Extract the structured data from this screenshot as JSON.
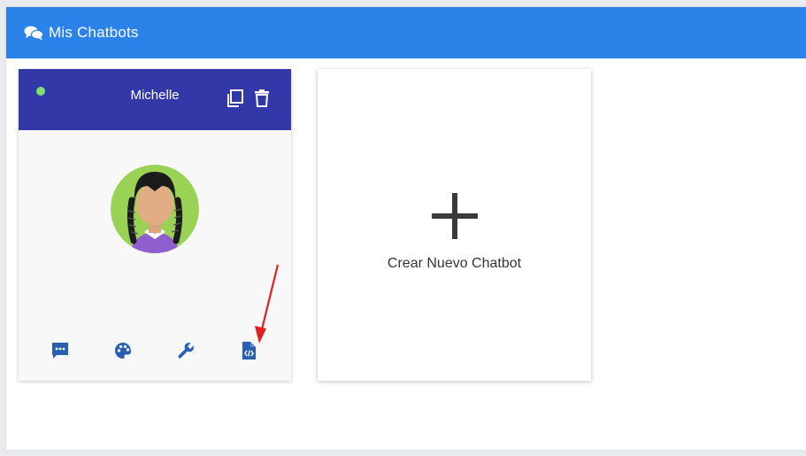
{
  "header": {
    "title": "Mis Chatbots",
    "icon": "chat-bubbles-icon",
    "color": "#2b83ea"
  },
  "bot_card": {
    "name": "Michelle",
    "status": "online",
    "status_color": "#7ee06e",
    "header_color": "#3338a8",
    "actions": [
      "copy-icon",
      "trash-icon"
    ],
    "toolbar": [
      "chat-message-icon",
      "palette-icon",
      "wrench-icon",
      "code-file-icon"
    ],
    "toolbar_color": "#2a5fb0"
  },
  "new_card": {
    "label": "Crear Nuevo Chatbot",
    "icon": "plus-icon"
  },
  "annotation": {
    "type": "arrow",
    "color": "#e02020"
  }
}
